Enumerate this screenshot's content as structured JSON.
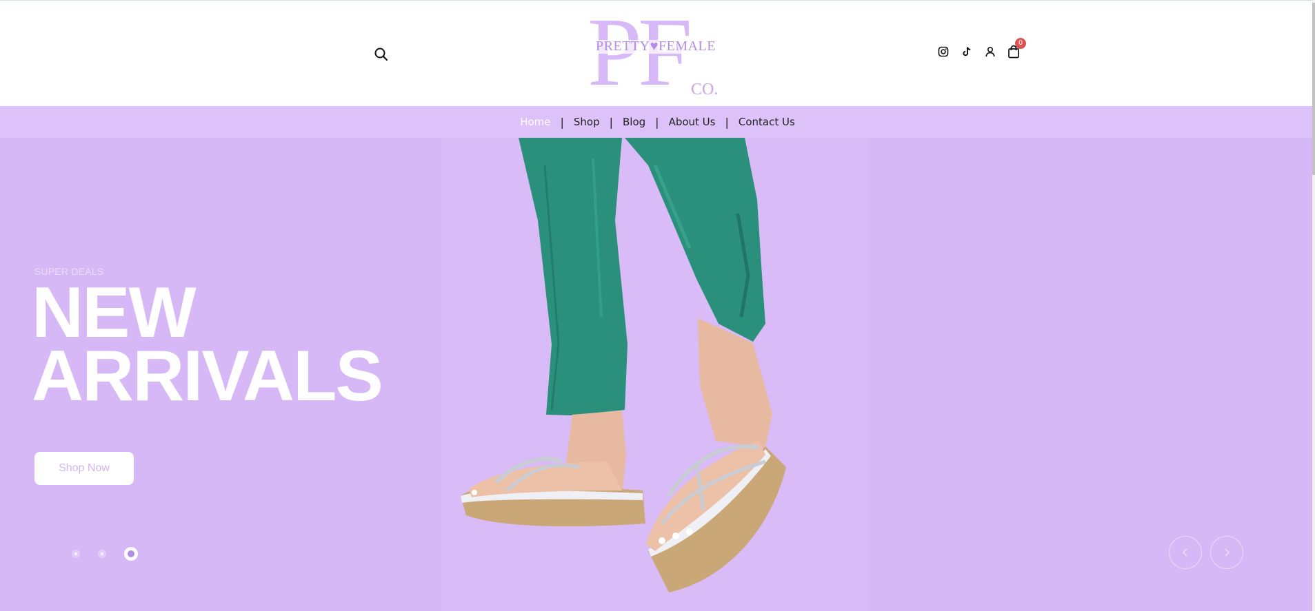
{
  "header": {
    "logo": {
      "letters": "PF",
      "word": "PRETTY♥FEMALE",
      "co": "CO."
    },
    "cart_count": "0",
    "icons": [
      "search-icon",
      "instagram-icon",
      "tiktok-icon",
      "user-icon",
      "cart-icon"
    ]
  },
  "nav": {
    "items": [
      {
        "label": "Home"
      },
      {
        "label": "Shop"
      },
      {
        "label": "Blog"
      },
      {
        "label": "About Us"
      },
      {
        "label": "Contact Us"
      }
    ],
    "separator": "|"
  },
  "hero": {
    "eyebrow": "SUPER DEALS",
    "headline_line1": "NEW",
    "headline_line2": "ARRIVALS",
    "cta_label": "Shop Now",
    "slide_count": 3,
    "active_slide": 3
  },
  "colors": {
    "accent": "#d7b8f7",
    "nav_bg": "#dcc2f8",
    "logo": "#d6b9f6",
    "cart_badge": "#d9534f"
  }
}
